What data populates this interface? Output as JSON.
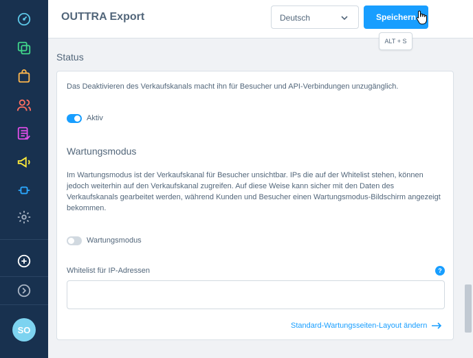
{
  "header": {
    "title": "OUTTRA Export",
    "language": "Deutsch",
    "save_label": "Speichern",
    "save_tooltip": "ALT + S"
  },
  "sidebar": {
    "items": [
      {
        "name": "dashboard",
        "icon": "speedometer-icon"
      },
      {
        "name": "catalogues",
        "icon": "stacked-squares-icon"
      },
      {
        "name": "orders",
        "icon": "shopping-bag-icon"
      },
      {
        "name": "customers",
        "icon": "users-icon"
      },
      {
        "name": "content",
        "icon": "list-layout-icon"
      },
      {
        "name": "marketing",
        "icon": "megaphone-icon"
      },
      {
        "name": "extensions",
        "icon": "plug-icon"
      },
      {
        "name": "settings",
        "icon": "gear-icon"
      }
    ],
    "add_icon": "plus-circle-icon",
    "collapse_icon": "chevron-right-circle-icon",
    "avatar_initials": "SO"
  },
  "status": {
    "section_title": "Status",
    "description": "Das Deaktivieren des Verkaufskanals macht ihn für Besucher und API-Verbindungen unzugänglich.",
    "active_label": "Aktiv",
    "active": true
  },
  "maintenance": {
    "title": "Wartungsmodus",
    "description": "Im Wartungsmodus ist der Verkaufskanal für Besucher unsichtbar. IPs die auf der Whitelist stehen, können jedoch weiterhin auf den Verkaufskanal zugreifen. Auf diese Weise kann sicher mit den Daten des Verkaufskanals gearbeitet werden, während Kunden und Besucher einen Wartungsmodus-Bildschirm angezeigt bekommen.",
    "toggle_label": "Wartungsmodus",
    "enabled": false,
    "ip_whitelist_label": "Whitelist für IP-Adressen",
    "ip_whitelist_value": "",
    "help": "?",
    "layout_link": "Standard-Wartungsseiten-Layout ändern"
  },
  "colors": {
    "sidebar_bg": "#18314f",
    "accent": "#189eff",
    "text": "#52667a"
  }
}
